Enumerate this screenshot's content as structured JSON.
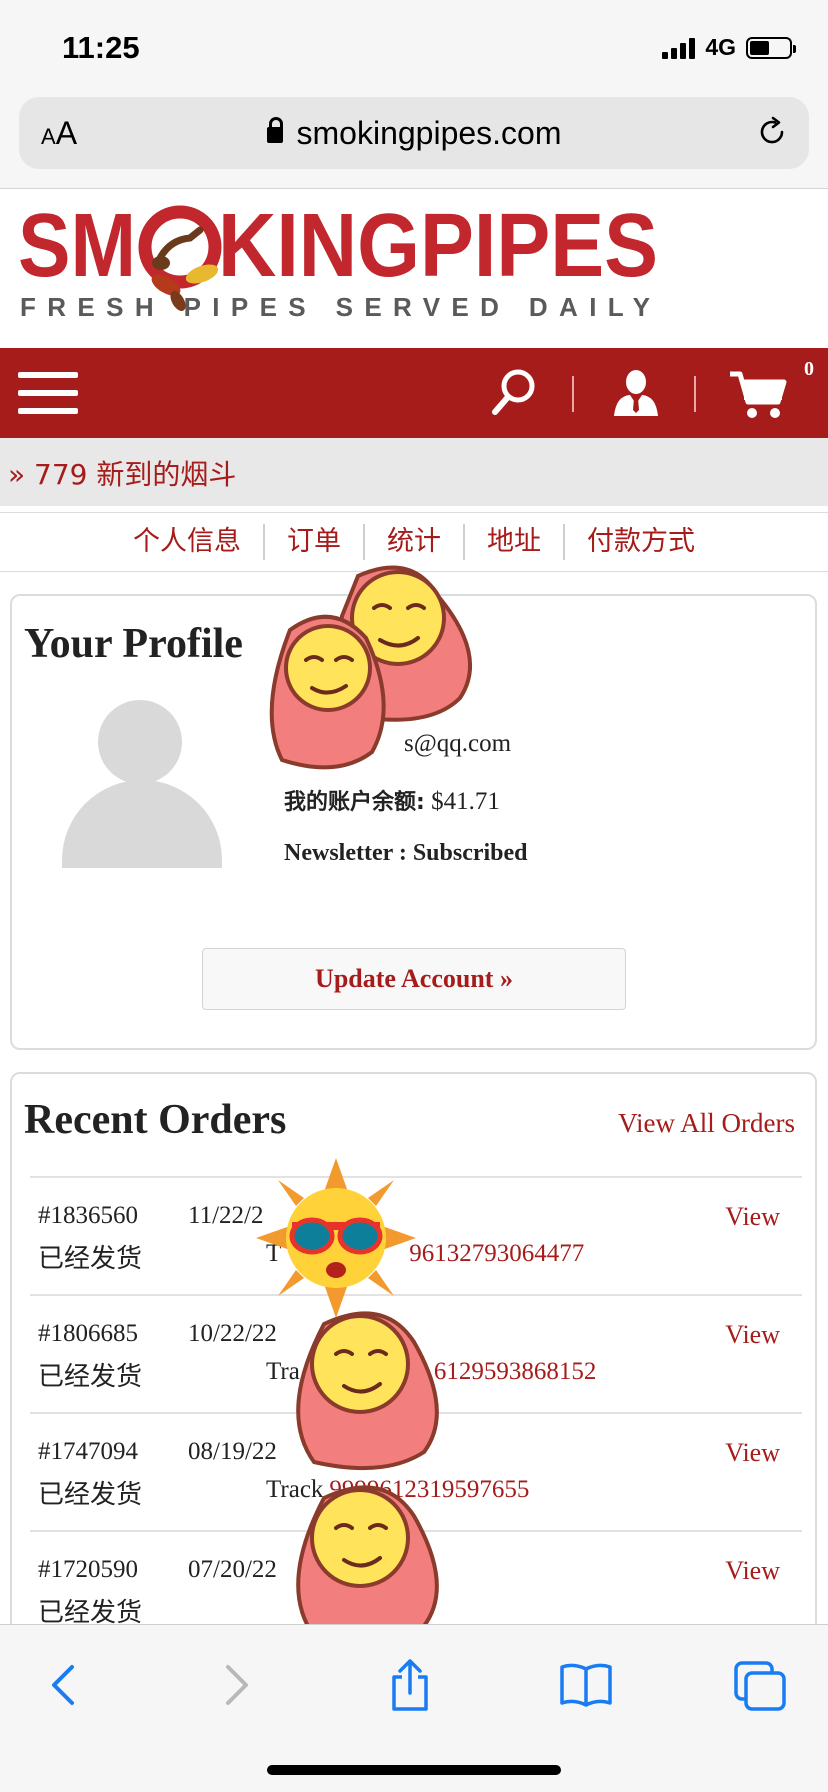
{
  "status_bar": {
    "time": "11:25",
    "network": "4G",
    "battery_level": 0.5
  },
  "browser": {
    "aa_small": "A",
    "aa_large": "A",
    "url": "smokingpipes.com"
  },
  "site": {
    "logo_part1": "SM",
    "logo_part2": "KINGPIPES",
    "tagline": "FRESH PIPES SERVED DAILY",
    "cart_count": "0",
    "promo": "» 779 新到的烟斗"
  },
  "account_tabs": [
    "个人信息",
    "订单",
    "统计",
    "地址",
    "付款方式"
  ],
  "profile": {
    "title": "Your Profile",
    "email_visible": "s@qq.com",
    "balance_label": "我的账户余额:",
    "balance_value": "$41.71",
    "newsletter": "Newsletter : Subscribed",
    "update_button": "Update Account »"
  },
  "orders": {
    "title": "Recent Orders",
    "view_all": "View All Orders",
    "rows": [
      {
        "number": "#1836560",
        "status": "已经发货",
        "date": "11/22/2",
        "tracking_prefix": "T",
        "tracking": "96132793064477",
        "view": "View"
      },
      {
        "number": "#1806685",
        "status": "已经发货",
        "date": "10/22/22",
        "tracking_prefix": "Tra",
        "tracking": "6129593868152",
        "view": "View"
      },
      {
        "number": "#1747094",
        "status": "已经发货",
        "date": "08/19/22",
        "tracking_prefix": "Track",
        "tracking": "9999612319597655",
        "view": "View"
      },
      {
        "number": "#1720590",
        "status": "已经发货",
        "date": "07/20/22",
        "tracking_prefix": "",
        "tracking": "",
        "view": "View"
      }
    ]
  },
  "colors": {
    "brand": "#a51c1a",
    "grey_bar": "#e8e8e8"
  }
}
